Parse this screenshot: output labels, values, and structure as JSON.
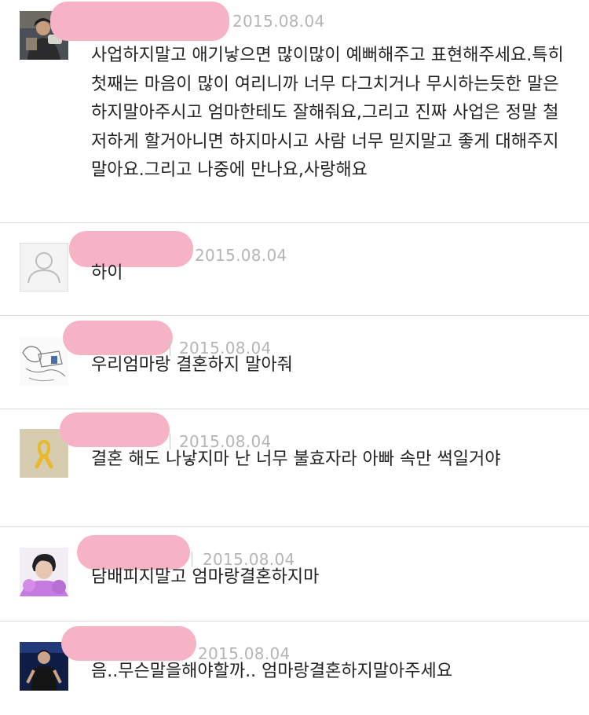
{
  "comments": [
    {
      "avatar": "person-photo-avatar",
      "date": "2015.08.04",
      "text": "사업하지말고 애기낳으면 많이많이 예뻐해주고 표현해주세요.특히 첫째는 마음이 많이 여리니까 너무 다그치거나 무시하는듯한 말은 하지말아주시고 엄마한테도 잘해줘요,그리고 진짜 사업은 정말 철저하게 할거아니면 하지마시고 사람 너무 믿지말고 좋게 대해주지말아요.그리고 나중에 만나요,사랑해요"
    },
    {
      "avatar": "default-user-icon",
      "date": "2015.08.04",
      "text": "하이"
    },
    {
      "avatar": "sketch-drawing-avatar",
      "date": "2015.08.04",
      "text": "우리엄마랑 결혼하지 말아줘"
    },
    {
      "avatar": "yellow-ribbon-avatar",
      "date": "2015.08.04",
      "text": "결혼 해도 나낳지마 난 너무 불효자라 아빠 속만 썩일거야"
    },
    {
      "avatar": "person-photo-avatar",
      "date": "2015.08.04",
      "text": "담배피지말고 엄마랑결혼하지마"
    },
    {
      "avatar": "concert-photo-avatar",
      "date": "2015.08.04",
      "text": "음..무슨말을해야할까.. 엄마랑결혼하지말아주세요"
    }
  ],
  "colors": {
    "redaction": "#f7b3c6",
    "date": "#b5b5b5",
    "divider": "#d9d9d9"
  }
}
